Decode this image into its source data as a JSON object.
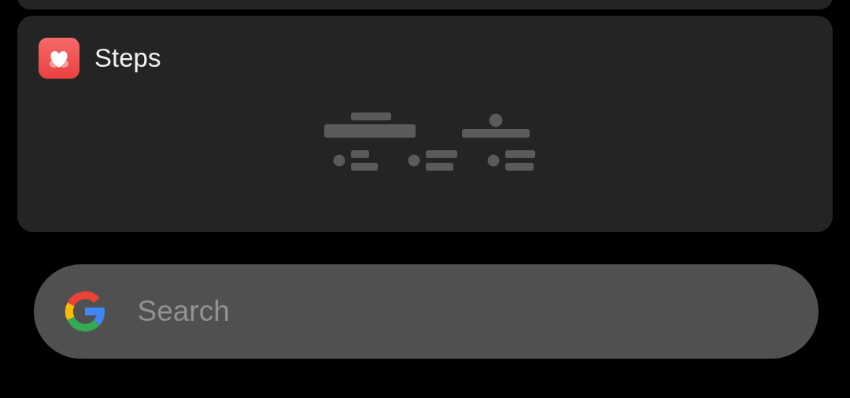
{
  "widget": {
    "title": "Steps"
  },
  "search": {
    "placeholder": "Search"
  }
}
